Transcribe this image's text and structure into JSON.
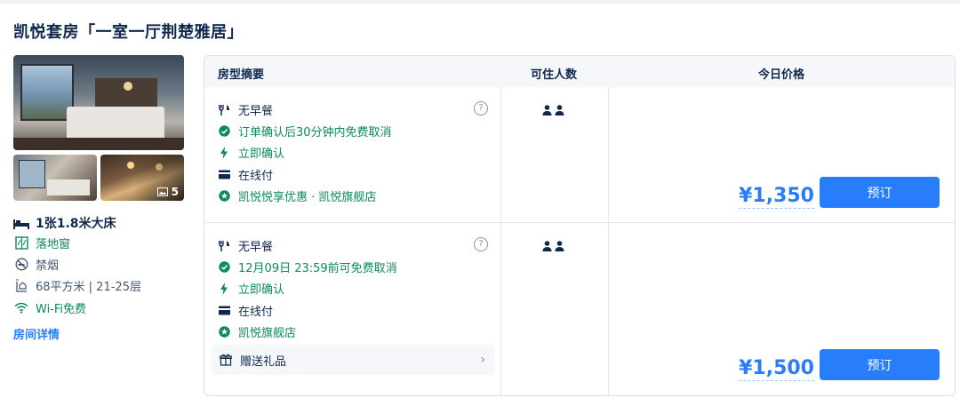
{
  "title": "凯悦套房「一室一厅荆楚雅居」",
  "gallery": {
    "photo_count": "5"
  },
  "features": {
    "bed": "1张1.8米大床",
    "window": "落地窗",
    "smoking": "禁烟",
    "area_floor": "68平方米 | 21-25层",
    "wifi": "Wi-Fi免费"
  },
  "room_detail_link": "房间详情",
  "table_header": {
    "summary": "房型摘要",
    "guests": "可住人数",
    "price": "今日价格"
  },
  "offers": [
    {
      "meal": "无早餐",
      "cancel": "订单确认后30分钟内免费取消",
      "confirm": "立即确认",
      "payment": "在线付",
      "benefit": "凯悦悦享优惠 · 凯悦旗舰店",
      "price": "¥1,350",
      "book_label": "预订"
    },
    {
      "meal": "无早餐",
      "cancel": "12月09日 23:59前可免费取消",
      "confirm": "立即确认",
      "payment": "在线付",
      "benefit": "凯悦旗舰店",
      "gift": "赠送礼品",
      "price": "¥1,500",
      "book_label": "预订"
    }
  ],
  "colors": {
    "accent": "#287dfa",
    "green": "#0a8a5d",
    "text": "#0f294d"
  }
}
